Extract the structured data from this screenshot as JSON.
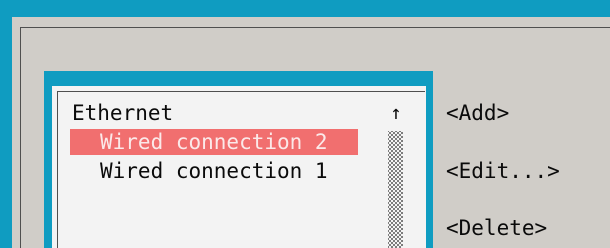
{
  "connection_list": {
    "group_label": "Ethernet",
    "items": [
      {
        "label": "Wired connection 2",
        "selected": true
      },
      {
        "label": "Wired connection 1",
        "selected": false
      }
    ],
    "scroll_up_glyph": "↑"
  },
  "buttons": {
    "add_label": "<Add>",
    "edit_label": "<Edit...>",
    "delete_label": "<Delete>"
  },
  "colors": {
    "frame_background": "#0f9cc1",
    "dialog_background": "#d0cdc8",
    "list_background": "#f3f3f3",
    "selection_background": "#f16f6f",
    "selection_text": "#fbe9e9",
    "text": "#0a0a0a"
  }
}
